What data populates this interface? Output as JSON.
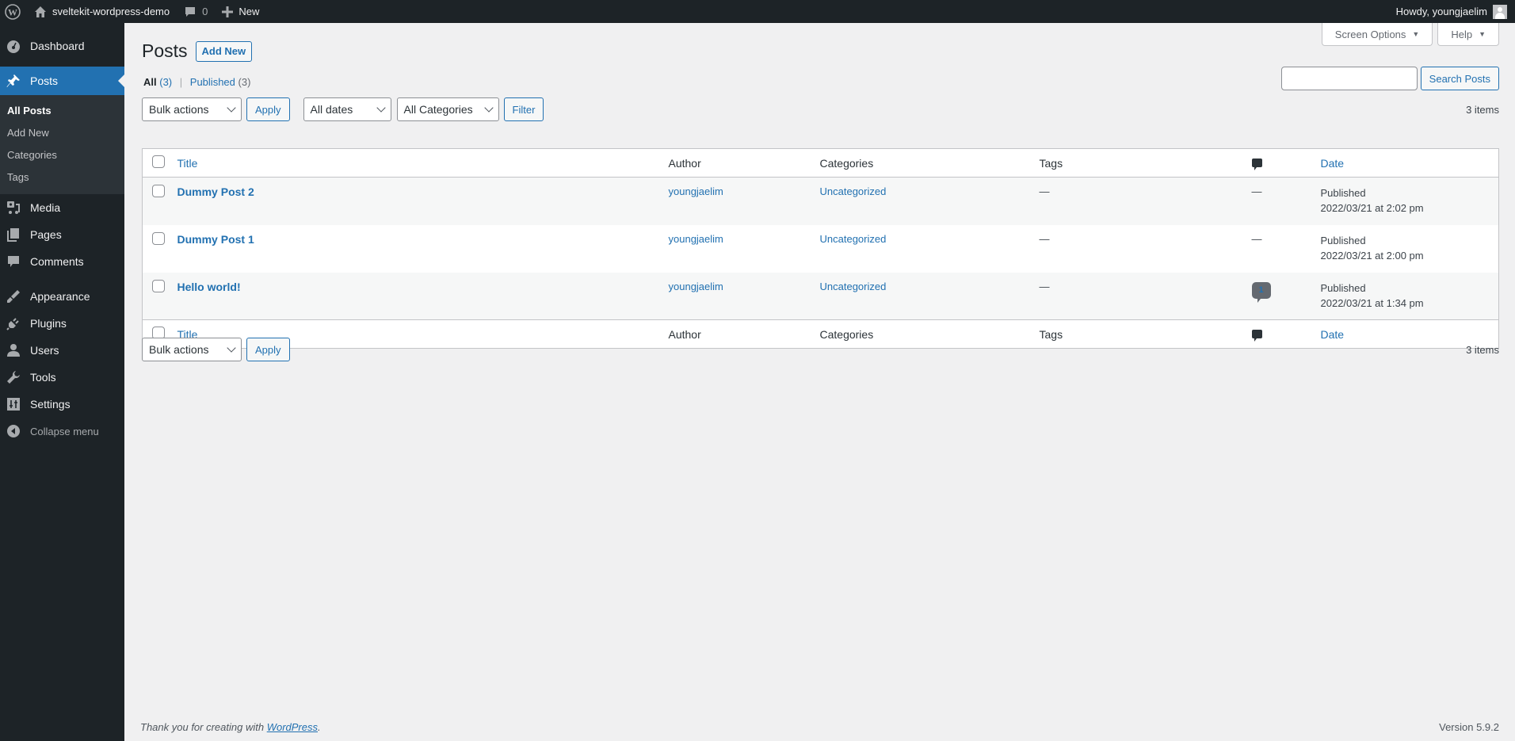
{
  "adminbar": {
    "site_name": "sveltekit-wordpress-demo",
    "comments_count": "0",
    "new_label": "New",
    "greeting": "Howdy, youngjaelim"
  },
  "sidebar": {
    "items": [
      {
        "label": "Dashboard",
        "icon": "dashboard-icon"
      },
      {
        "label": "Posts",
        "icon": "pin-icon",
        "current": true
      },
      {
        "label": "Media",
        "icon": "media-icon"
      },
      {
        "label": "Pages",
        "icon": "pages-icon"
      },
      {
        "label": "Comments",
        "icon": "comments-icon"
      },
      {
        "label": "Appearance",
        "icon": "paintbrush-icon"
      },
      {
        "label": "Plugins",
        "icon": "plugin-icon"
      },
      {
        "label": "Users",
        "icon": "user-icon"
      },
      {
        "label": "Tools",
        "icon": "wrench-icon"
      },
      {
        "label": "Settings",
        "icon": "settings-icon"
      }
    ],
    "posts_submenu": [
      "All Posts",
      "Add New",
      "Categories",
      "Tags"
    ],
    "collapse_label": "Collapse menu"
  },
  "screen_meta": {
    "screen_options": "Screen Options",
    "help": "Help"
  },
  "page": {
    "title": "Posts",
    "add_new": "Add New"
  },
  "views": {
    "all_label": "All",
    "all_count": "(3)",
    "separator": "|",
    "published_label": "Published",
    "published_count": "(3)"
  },
  "search": {
    "value": "",
    "button": "Search Posts"
  },
  "filters": {
    "bulk_actions": "Bulk actions",
    "apply": "Apply",
    "dates": "All dates",
    "categories": "All Categories",
    "filter": "Filter",
    "items_count": "3 items"
  },
  "table": {
    "columns": {
      "title": "Title",
      "author": "Author",
      "categories": "Categories",
      "tags": "Tags",
      "comments_icon": "comment-bubble-icon",
      "date": "Date"
    },
    "rows": [
      {
        "title": "Dummy Post 2",
        "author": "youngjaelim",
        "categories": "Uncategorized",
        "tags": "—",
        "comments": "—",
        "status": "Published",
        "date": "2022/03/21 at 2:02 pm"
      },
      {
        "title": "Dummy Post 1",
        "author": "youngjaelim",
        "categories": "Uncategorized",
        "tags": "—",
        "comments": "—",
        "status": "Published",
        "date": "2022/03/21 at 2:00 pm"
      },
      {
        "title": "Hello world!",
        "author": "youngjaelim",
        "categories": "Uncategorized",
        "tags": "—",
        "comments": "1",
        "status": "Published",
        "date": "2022/03/21 at 1:34 pm"
      }
    ]
  },
  "footer": {
    "thanks_prefix": "Thank you for creating with ",
    "wordpress_link": "WordPress",
    "thanks_suffix": ".",
    "version": "Version 5.9.2"
  }
}
